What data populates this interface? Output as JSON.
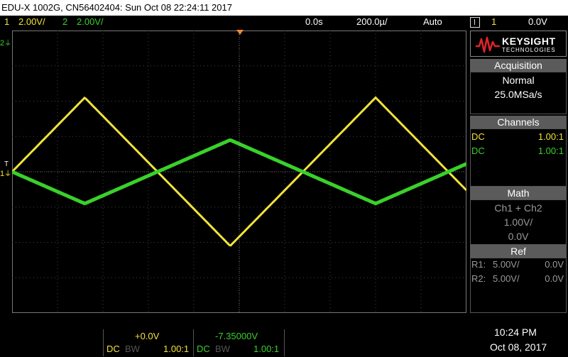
{
  "title_bar": "EDU-X 1002G, CN56402404: Sun Oct 08 22:24:11 2017",
  "status": {
    "ch1_num": "1",
    "ch1_scale": "2.00V/",
    "ch2_num": "2",
    "ch2_scale": "2.00V/",
    "time_delay": "0.0s",
    "time_scale": "200.0µ/",
    "trigger_mode": "Auto",
    "trigger_source": "1",
    "trigger_level": "0.0V"
  },
  "markers": {
    "ch2_marker": "2",
    "ch1_marker": "1",
    "trigger_marker": "T"
  },
  "sidebar": {
    "brand": "KEYSIGHT",
    "brand_sub": "TECHNOLOGIES",
    "acquisition_header": "Acquisition",
    "acquisition_mode": "Normal",
    "acquisition_rate": "25.0MSa/s",
    "channels_header": "Channels",
    "channels": [
      {
        "coupling": "DC",
        "probe": "1.00:1"
      },
      {
        "coupling": "DC",
        "probe": "1.00:1"
      }
    ],
    "math_header": "Math",
    "math_operator": "Ch1 + Ch2",
    "math_scale": "1.00V/",
    "math_offset": "0.0V",
    "ref_header": "Ref",
    "refs": [
      {
        "label": "R1:",
        "scale": "5.00V/",
        "offset": "0.0V"
      },
      {
        "label": "R2:",
        "scale": "5.00V/",
        "offset": "0.0V"
      }
    ]
  },
  "bottom": {
    "ch1_offset": "+0.0V",
    "ch2_offset": "-7.35000V",
    "ch1_coupling": "DC",
    "ch1_bw": "BW",
    "ch1_probe": "1.00:1",
    "ch2_coupling": "DC",
    "ch2_bw": "BW",
    "ch2_probe": "1.00:1",
    "time": "10:24 PM",
    "date": "Oct 08, 2017"
  },
  "colors": {
    "ch1": "#f2e33a",
    "ch2": "#39d12b",
    "trigger": "#f08a24",
    "grid": "#444444"
  },
  "waveforms": {
    "ch1": {
      "type": "triangle",
      "amplitude_div": 2.1,
      "period_div": 6.4,
      "phase_at_left": "rising_from_zero"
    },
    "ch2": {
      "type": "triangle",
      "amplitude_div": 0.9,
      "period_div": 6.4,
      "phase_at_left": "falling_from_zero"
    }
  }
}
